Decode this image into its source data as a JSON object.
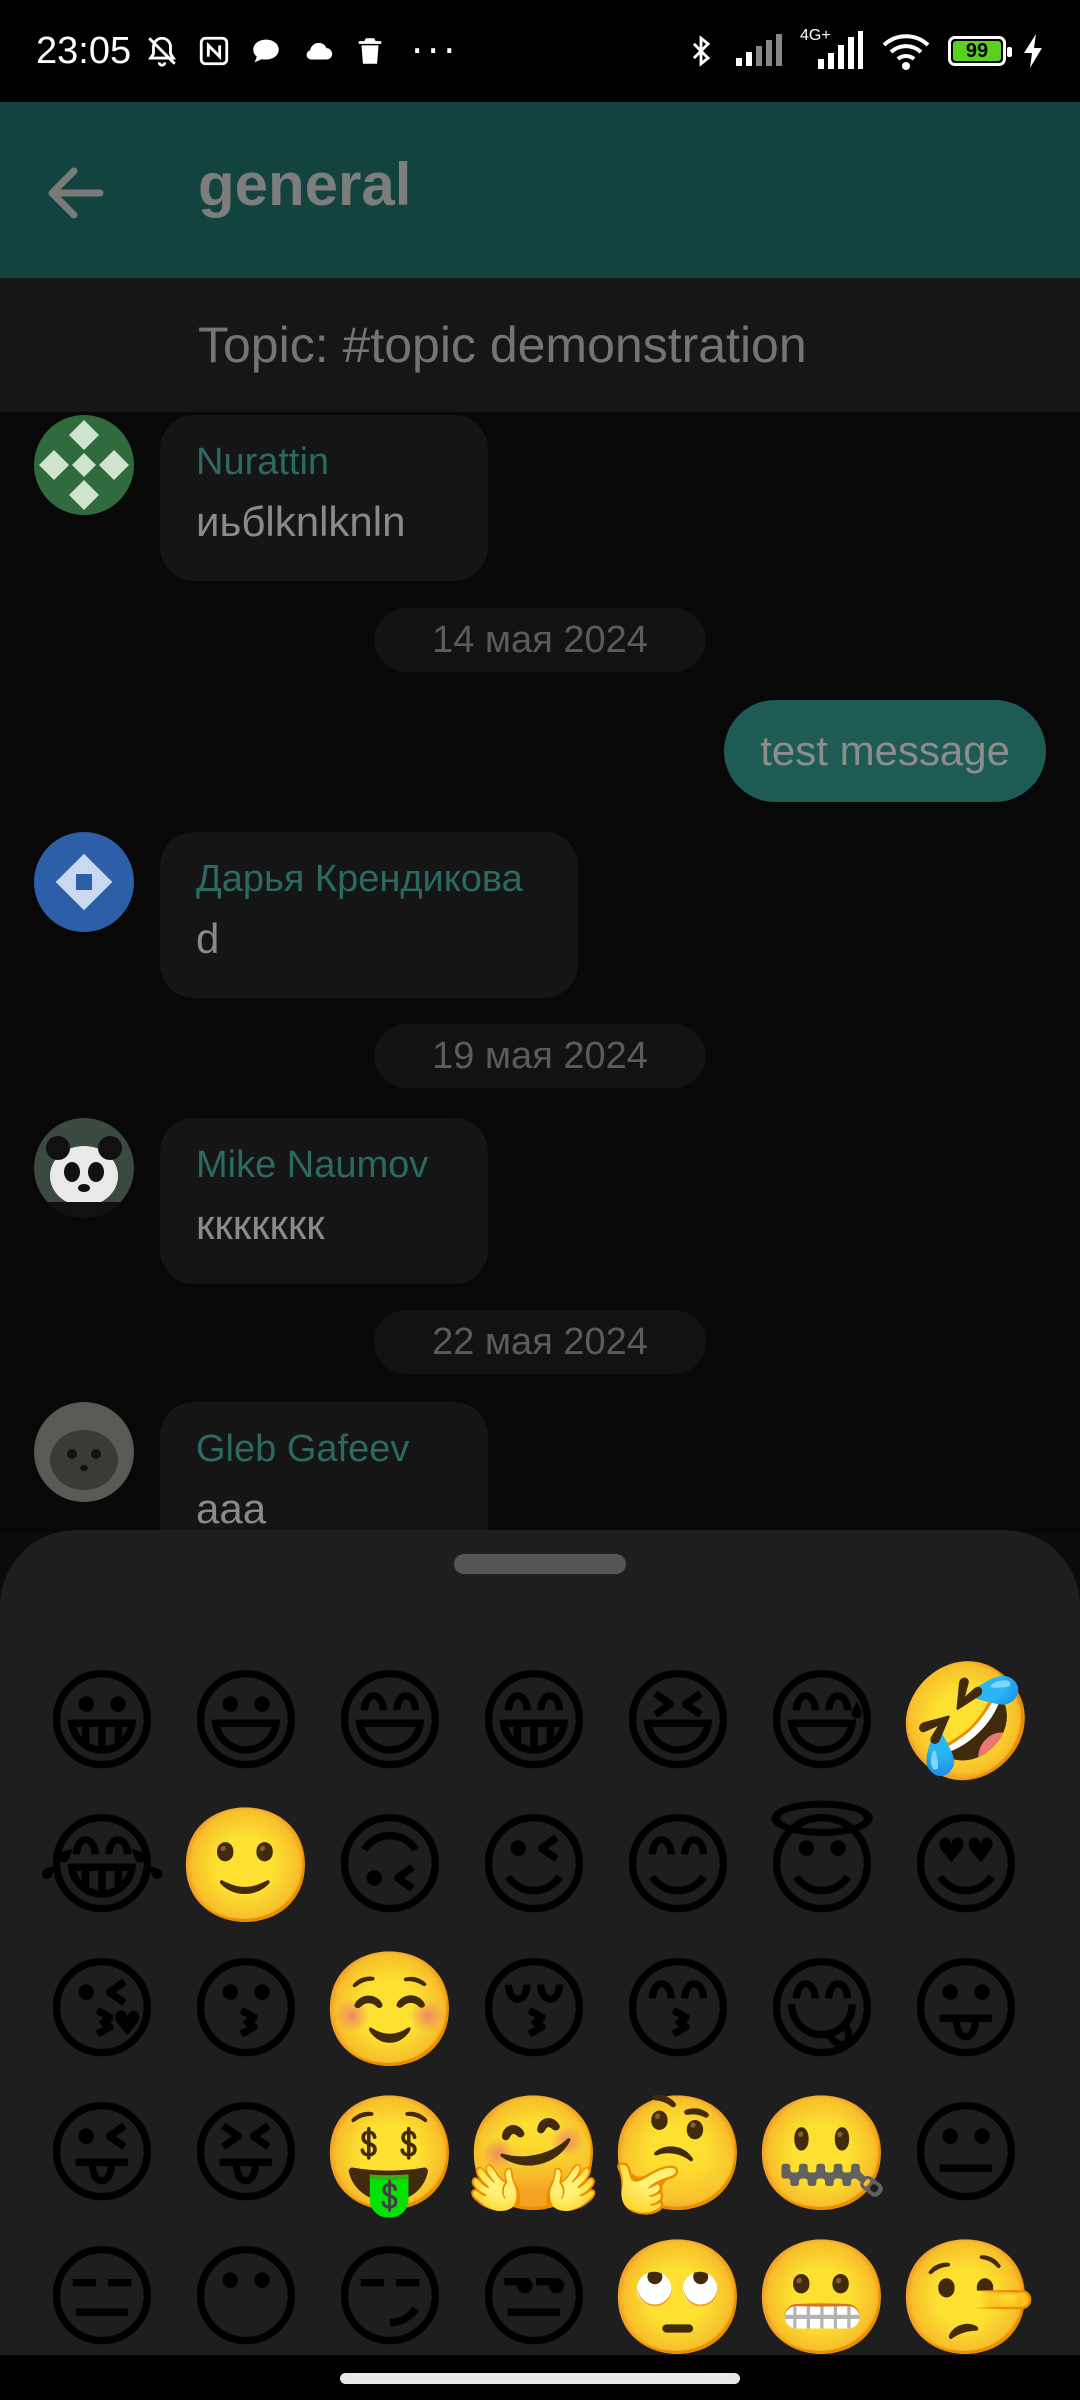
{
  "status_bar": {
    "time": "23:05",
    "battery": "99",
    "battery_fraction": 0.99,
    "network": "4G+",
    "left_icons": [
      "mute-bell-icon",
      "nfc-icon",
      "chat-icon",
      "cloud-icon",
      "trash-icon"
    ],
    "right_icons": [
      "bluetooth-icon",
      "signal-icon",
      "signal-4g-icon",
      "wifi-icon",
      "battery-icon",
      "charging-icon"
    ]
  },
  "app_bar": {
    "title": "general",
    "back_icon": "arrow-left-icon"
  },
  "topic": {
    "text": "Topic: #topic demonstration"
  },
  "messages": [
    {
      "sender": "Nurattin",
      "text": "иьбlknlknln",
      "avatar": "green-pattern-avatar"
    },
    {
      "date": "14 мая 2024"
    },
    {
      "own_text": "test message"
    },
    {
      "sender": "Дарья Крендикова",
      "text": "d",
      "avatar": "blue-pattern-avatar"
    },
    {
      "date": "19 мая 2024"
    },
    {
      "sender": "Mike Naumov",
      "text": "ккккккк",
      "avatar": "panda-avatar"
    },
    {
      "date": "22 мая 2024"
    },
    {
      "sender": "Gleb Gafeev",
      "text": "aaa",
      "avatar": "hamster-avatar"
    }
  ],
  "emoji_picker": {
    "emojis": [
      "😀",
      "😃",
      "😄",
      "😁",
      "😆",
      "😅",
      "🤣",
      "😂",
      "🙂",
      "🙃",
      "😉",
      "😊",
      "😇",
      "😍",
      "😘",
      "😗",
      "☺️",
      "😚",
      "😙",
      "😋",
      "😛",
      "😜",
      "😝",
      "🤑",
      "🤗",
      "🤔",
      "🤐",
      "😐",
      "😑",
      "😶",
      "😏",
      "😒",
      "🙄",
      "😬",
      "🤥"
    ]
  },
  "colors": {
    "app_bar": "#12433f",
    "accent": "#1d5b54",
    "sender_name": "#2a6a62",
    "sheet": "#1e1e1e"
  }
}
